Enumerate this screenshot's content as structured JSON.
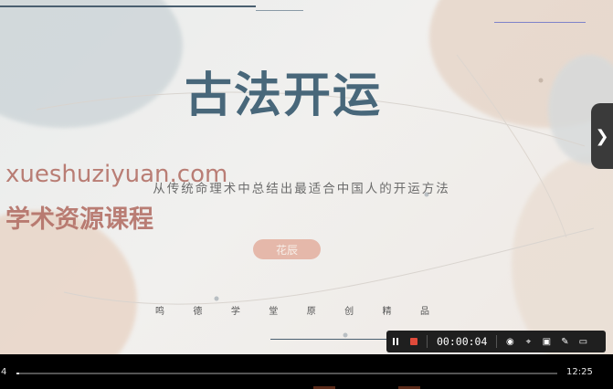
{
  "slide": {
    "title": "古法开运",
    "subtitle": "从传统命理术中总结出最适合中国人的开运方法",
    "pill_label": "花辰",
    "brand_chars": [
      "鸣",
      "德",
      "学",
      "堂",
      "原",
      "创",
      "精",
      "品"
    ]
  },
  "watermark": {
    "url": "xueshuziyuan.com",
    "name": "学术资源课程"
  },
  "recorder": {
    "elapsed": "00:00:04",
    "pause_icon": "pause-icon",
    "stop_icon": "stop-icon"
  },
  "player": {
    "current_time": "4",
    "total_time": "12:25",
    "progress_fraction": 0.005
  },
  "colors": {
    "title": "#48677a",
    "watermark": "#b06a60",
    "pill": "#e5b8aa",
    "accent_blue": "#4a5f70",
    "blob_peach": "#e8d2c3",
    "blob_grey": "#c9d2d6"
  }
}
